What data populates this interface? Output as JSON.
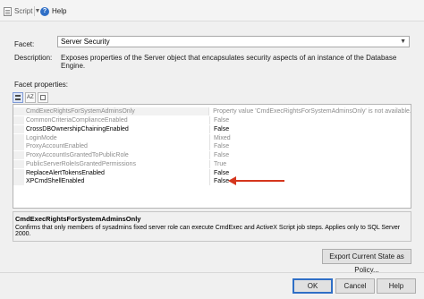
{
  "toolbar": {
    "script_label": "Script",
    "help_label": "Help"
  },
  "facet": {
    "label": "Facet:",
    "selected": "Server Security"
  },
  "description": {
    "label": "Description:",
    "text": "Exposes properties of the Server object that encapsulates security aspects of an instance of the Database Engine."
  },
  "facet_properties": {
    "label": "Facet properties:",
    "rows": [
      {
        "name": "CmdExecRightsForSystemAdminsOnly",
        "value": "Property value 'CmdExecRightsForSystemAdminsOnly' is not available.",
        "disabled": true
      },
      {
        "name": "CommonCriteriaComplianceEnabled",
        "value": "False",
        "disabled": true
      },
      {
        "name": "CrossDBOwnershipChainingEnabled",
        "value": "False",
        "disabled": false
      },
      {
        "name": "LoginMode",
        "value": "Mixed",
        "disabled": true
      },
      {
        "name": "ProxyAccountEnabled",
        "value": "False",
        "disabled": true
      },
      {
        "name": "ProxyAccountIsGrantedToPublicRole",
        "value": "False",
        "disabled": true
      },
      {
        "name": "PublicServerRoleIsGrantedPermissions",
        "value": "True",
        "disabled": true
      },
      {
        "name": "ReplaceAlertTokensEnabled",
        "value": "False",
        "disabled": false
      },
      {
        "name": "XPCmdShellEnabled",
        "value": "False",
        "disabled": false
      }
    ]
  },
  "desc_panel": {
    "title": "CmdExecRightsForSystemAdminsOnly",
    "text": "Confirms that only members of sysadmins fixed server role can execute CmdExec and ActiveX Script job steps. Applies only to SQL Server 2000."
  },
  "buttons": {
    "export": "Export Current State as Policy...",
    "ok": "OK",
    "cancel": "Cancel",
    "help": "Help"
  },
  "colors": {
    "accent_border": "#2f6fc6",
    "annotation_arrow": "#d5361d",
    "disabled_text": "#8c8c8c"
  }
}
